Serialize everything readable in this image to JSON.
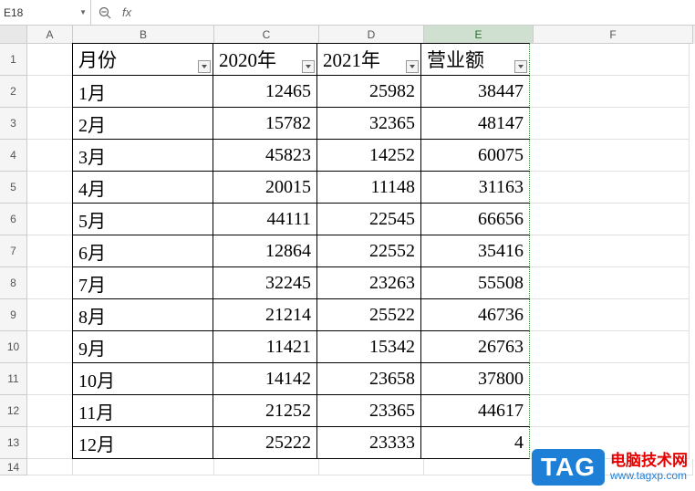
{
  "nameBox": "E18",
  "formulaLabel": "fx",
  "columns": [
    "A",
    "B",
    "C",
    "D",
    "E",
    "F"
  ],
  "activeColumn": "E",
  "headers": {
    "B": "月份",
    "C": "2020年",
    "D": "2021年",
    "E": "营业额"
  },
  "rows": [
    {
      "n": "1",
      "B": "月份",
      "C": "2020年",
      "D": "2021年",
      "E": "营业额",
      "isHeader": true
    },
    {
      "n": "2",
      "B": "1月",
      "C": "12465",
      "D": "25982",
      "E": "38447"
    },
    {
      "n": "3",
      "B": "2月",
      "C": "15782",
      "D": "32365",
      "E": "48147"
    },
    {
      "n": "4",
      "B": "3月",
      "C": "45823",
      "D": "14252",
      "E": "60075"
    },
    {
      "n": "5",
      "B": "4月",
      "C": "20015",
      "D": "11148",
      "E": "31163"
    },
    {
      "n": "6",
      "B": "5月",
      "C": "44111",
      "D": "22545",
      "E": "66656"
    },
    {
      "n": "7",
      "B": "6月",
      "C": "12864",
      "D": "22552",
      "E": "35416"
    },
    {
      "n": "8",
      "B": "7月",
      "C": "32245",
      "D": "23263",
      "E": "55508"
    },
    {
      "n": "9",
      "B": "8月",
      "C": "21214",
      "D": "25522",
      "E": "46736"
    },
    {
      "n": "10",
      "B": "9月",
      "C": "11421",
      "D": "15342",
      "E": "26763"
    },
    {
      "n": "11",
      "B": "10月",
      "C": "14142",
      "D": "23658",
      "E": "37800"
    },
    {
      "n": "12",
      "B": "11月",
      "C": "21252",
      "D": "23365",
      "E": "44617"
    },
    {
      "n": "13",
      "B": "12月",
      "C": "25222",
      "D": "23333",
      "E": "4"
    }
  ],
  "extraRow": "14",
  "watermark": {
    "badge": "TAG",
    "cn": "电脑技术网",
    "url": "www.tagxp.com"
  },
  "chart_data": {
    "type": "table",
    "title": "",
    "columns": [
      "月份",
      "2020年",
      "2021年",
      "营业额"
    ],
    "rows": [
      [
        "1月",
        12465,
        25982,
        38447
      ],
      [
        "2月",
        15782,
        32365,
        48147
      ],
      [
        "3月",
        45823,
        14252,
        60075
      ],
      [
        "4月",
        20015,
        11148,
        31163
      ],
      [
        "5月",
        44111,
        22545,
        66656
      ],
      [
        "6月",
        12864,
        22552,
        35416
      ],
      [
        "7月",
        32245,
        23263,
        55508
      ],
      [
        "8月",
        21214,
        25522,
        46736
      ],
      [
        "9月",
        11421,
        15342,
        26763
      ],
      [
        "10月",
        14142,
        23658,
        37800
      ],
      [
        "11月",
        21252,
        23365,
        44617
      ],
      [
        "12月",
        25222,
        23333,
        null
      ]
    ]
  }
}
